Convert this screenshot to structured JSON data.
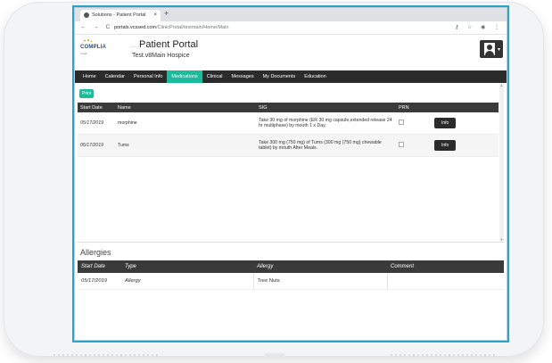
{
  "browser": {
    "tab_title": "Solutions - Patient Portal",
    "tab_close": "×",
    "new_tab": "+",
    "nav_icons": "← → C",
    "url_host": "portals.vcssed.com",
    "url_path": "/ClinicPortal/testmain/Home/Main",
    "tools": "⚷ ☆ ◉ ⋮"
  },
  "header": {
    "logo_text": "COMPLIA",
    "logo_sub": "health",
    "title_prefix": "......",
    "title": "Patient Portal",
    "org": "Test.v8Main Hospice",
    "avatar_caret": "▾"
  },
  "nav": {
    "items": [
      "Home",
      "Calendar",
      "Personal Info",
      "Medications",
      "Clinical",
      "Messages",
      "My Documents",
      "Education"
    ],
    "active": "Medications"
  },
  "medications": {
    "print_label": "Print",
    "columns": [
      "Start Date",
      "Name",
      "SIG",
      "PRN",
      ""
    ],
    "rows": [
      {
        "start_date": "05/17/2019",
        "name": "morphine",
        "sig": "Take 30 mg of morphine (ER 30 mg capsule,extended release 24 hr multiphase) by mouth 1 x Day.",
        "info_label": "Info"
      },
      {
        "start_date": "05/17/2019",
        "name": "Tums",
        "sig": "Take 300 mg (750 mg) of Tums (300 mg (750 mg) chewable tablet) by mouth After Meals.",
        "info_label": "Info"
      }
    ]
  },
  "allergies": {
    "title": "Allergies",
    "columns": [
      "Start Date",
      "Type",
      "Allergy",
      "Comment"
    ],
    "rows": [
      {
        "start_date": "05/17/2019",
        "type": "Allergy",
        "allergy": "Tree Nuts",
        "comment": ""
      }
    ]
  },
  "colors": {
    "accent": "#1abc9c",
    "nav_bg": "#2b2b2b",
    "frame": "#2aa3c8"
  }
}
